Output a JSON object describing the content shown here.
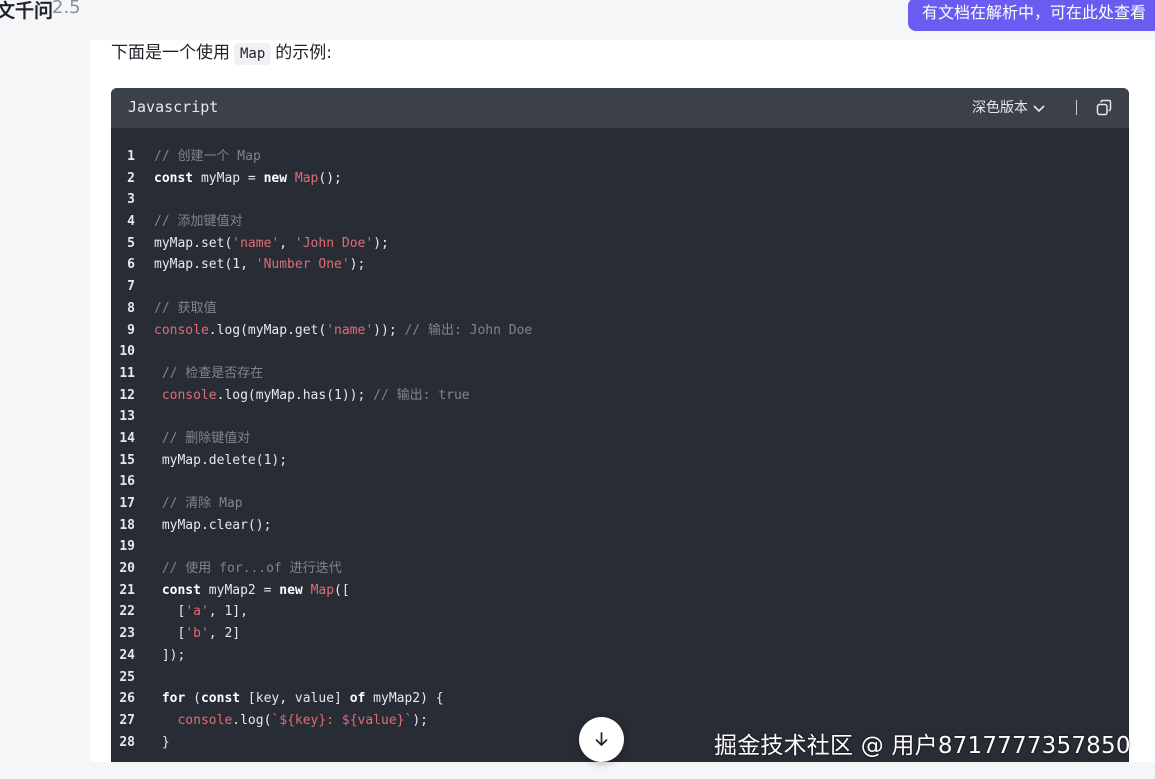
{
  "header": {
    "title": "文千问",
    "version": "2.5",
    "notice": "有文档在解析中，可在此处查看"
  },
  "article": {
    "intro_before": "下面是一个使用",
    "intro_code": "Map",
    "intro_after": "的示例:"
  },
  "code_block": {
    "language": "Javascript",
    "theme_label": "深色版本",
    "lines": [
      {
        "n": "1",
        "text": "// 创建一个 Map"
      },
      {
        "n": "2",
        "text": "const myMap = new Map();"
      },
      {
        "n": "3",
        "text": ""
      },
      {
        "n": "4",
        "text": "// 添加键值对"
      },
      {
        "n": "5",
        "text": "myMap.set('name', 'John Doe');"
      },
      {
        "n": "6",
        "text": "myMap.set(1, 'Number One');"
      },
      {
        "n": "7",
        "text": ""
      },
      {
        "n": "8",
        "text": "// 获取值"
      },
      {
        "n": "9",
        "text": "console.log(myMap.get('name')); // 输出: John Doe"
      },
      {
        "n": "10",
        "text": ""
      },
      {
        "n": "11",
        "text": " // 检查是否存在"
      },
      {
        "n": "12",
        "text": " console.log(myMap.has(1)); // 输出: true"
      },
      {
        "n": "13",
        "text": ""
      },
      {
        "n": "14",
        "text": " // 删除键值对"
      },
      {
        "n": "15",
        "text": " myMap.delete(1);"
      },
      {
        "n": "16",
        "text": ""
      },
      {
        "n": "17",
        "text": " // 清除 Map"
      },
      {
        "n": "18",
        "text": " myMap.clear();"
      },
      {
        "n": "19",
        "text": ""
      },
      {
        "n": "20",
        "text": " // 使用 for...of 进行迭代"
      },
      {
        "n": "21",
        "text": " const myMap2 = new Map(["
      },
      {
        "n": "22",
        "text": "   ['a', 1],"
      },
      {
        "n": "23",
        "text": "   ['b', 2]"
      },
      {
        "n": "24",
        "text": " ]);"
      },
      {
        "n": "25",
        "text": ""
      },
      {
        "n": "26",
        "text": " for (const [key, value] of myMap2) {"
      },
      {
        "n": "27",
        "text": "   console.log(`${key}: ${value}`);"
      },
      {
        "n": "28",
        "text": " }"
      }
    ]
  },
  "watermark": "掘金技术社区 @ 用户8717777357850",
  "colors": {
    "accent": "#6a5cf0",
    "code_bg": "#282c34",
    "code_header_bg": "#3c4049",
    "comment": "#7f848e",
    "string": "#e06c75"
  },
  "icons": {
    "theme_dropdown": "chevron-down-icon",
    "copy": "copy-icon",
    "scroll": "arrow-down-icon"
  }
}
